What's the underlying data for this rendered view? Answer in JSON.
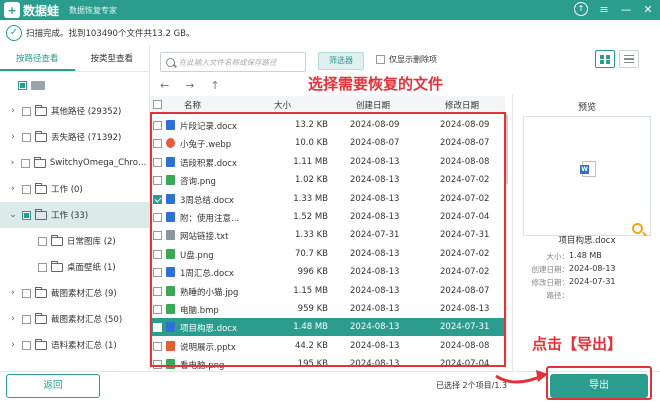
{
  "titlebar": {
    "logo_glyph": "+",
    "app_name": "数据蛙",
    "subtitle": "数据恢复专家",
    "update_glyph": "↑",
    "menu_glyph": "≡",
    "min_glyph": "—",
    "close_glyph": "✕"
  },
  "scan": {
    "check_glyph": "✓",
    "status": "扫描完成。找到103490个文件共13.2 GB。"
  },
  "left_panel": {
    "tabs": [
      {
        "label": "按路径查看",
        "active": true
      },
      {
        "label": "按类型查看",
        "active": false
      }
    ],
    "tree": [
      {
        "label": "",
        "indent": 0,
        "arrow": "",
        "state": "partial",
        "icon": "drive"
      },
      {
        "label": "其他路径 (29352)",
        "indent": 1,
        "arrow": "›",
        "state": "none",
        "icon": "folder"
      },
      {
        "label": "丢失路径 (71392)",
        "indent": 1,
        "arrow": "›",
        "state": "none",
        "icon": "folder"
      },
      {
        "label": "SwitchyOmega_Chromium",
        "indent": 1,
        "arrow": "›",
        "state": "none",
        "icon": "folder"
      },
      {
        "label": "工作 (0)",
        "indent": 1,
        "arrow": "›",
        "state": "none",
        "icon": "folder"
      },
      {
        "label": "工作 (33)",
        "indent": 1,
        "arrow": "⌄",
        "state": "partial",
        "icon": "folder",
        "selected": true
      },
      {
        "label": "日常图库 (2)",
        "indent": 2,
        "arrow": "",
        "state": "none",
        "icon": "folder"
      },
      {
        "label": "桌面壁纸 (1)",
        "indent": 2,
        "arrow": "",
        "state": "none",
        "icon": "folder"
      },
      {
        "label": "截图素材汇总 (9)",
        "indent": 1,
        "arrow": "›",
        "state": "none",
        "icon": "folder"
      },
      {
        "label": "截图素材汇总 (50)",
        "indent": 1,
        "arrow": "›",
        "state": "none",
        "icon": "folder"
      },
      {
        "label": "语料素材汇总 (1)",
        "indent": 1,
        "arrow": "›",
        "state": "none",
        "icon": "folder"
      }
    ]
  },
  "toolbar": {
    "search_placeholder": "在此输入文件名称或保存路径",
    "filter_label": "筛选器",
    "show_deleted_label": "仅显示删除项"
  },
  "nav": {
    "back_glyph": "←",
    "forward_glyph": "→",
    "up_glyph": "↑"
  },
  "annotation": {
    "title": "选择需要恢复的文件",
    "export_hint": "点击【导出】"
  },
  "table": {
    "columns": [
      "名称",
      "大小",
      "创建日期",
      "修改日期"
    ],
    "rows": [
      {
        "name": "片段记录.docx",
        "size": "13.2 KB",
        "created": "2024-08-09",
        "modified": "2024-08-09",
        "type": "doc",
        "checked": false,
        "selected": false
      },
      {
        "name": "小兔子.webp",
        "size": "10.0 KB",
        "created": "2024-08-07",
        "modified": "2024-08-07",
        "type": "webp",
        "checked": false,
        "selected": false
      },
      {
        "name": "语段积累.docx",
        "size": "1.11 MB",
        "created": "2024-08-13",
        "modified": "2024-08-08",
        "type": "doc",
        "checked": false,
        "selected": false
      },
      {
        "name": "咨询.png",
        "size": "1.02 KB",
        "created": "2024-08-13",
        "modified": "2024-07-02",
        "type": "img",
        "checked": false,
        "selected": false
      },
      {
        "name": "3周总结.docx",
        "size": "1.33 MB",
        "created": "2024-08-13",
        "modified": "2024-07-02",
        "type": "doc",
        "checked": true,
        "selected": false
      },
      {
        "name": "附：使用注意...",
        "size": "1.52 MB",
        "created": "2024-08-13",
        "modified": "2024-07-04",
        "type": "doc",
        "checked": false,
        "selected": false
      },
      {
        "name": "网站链接.txt",
        "size": "1.33 KB",
        "created": "2024-07-31",
        "modified": "2024-07-31",
        "type": "txt",
        "checked": false,
        "selected": false
      },
      {
        "name": "U盘.png",
        "size": "70.7 KB",
        "created": "2024-08-13",
        "modified": "2024-07-02",
        "type": "img",
        "checked": false,
        "selected": false
      },
      {
        "name": "1周汇总.docx",
        "size": "996 KB",
        "created": "2024-08-13",
        "modified": "2024-07-02",
        "type": "doc",
        "checked": false,
        "selected": false
      },
      {
        "name": "熟睡的小猫.jpg",
        "size": "1.15 MB",
        "created": "2024-08-13",
        "modified": "2024-08-07",
        "type": "img",
        "checked": false,
        "selected": false
      },
      {
        "name": "电脑.bmp",
        "size": "959 KB",
        "created": "2024-08-13",
        "modified": "2024-08-13",
        "type": "img",
        "checked": false,
        "selected": false
      },
      {
        "name": "项目构思.docx",
        "size": "1.48 MB",
        "created": "2024-08-13",
        "modified": "2024-07-31",
        "type": "doc",
        "checked": true,
        "selected": true
      },
      {
        "name": "说明展示.pptx",
        "size": "44.2 KB",
        "created": "2024-08-13",
        "modified": "2024-08-08",
        "type": "ppt",
        "checked": false,
        "selected": false
      },
      {
        "name": "看电脑.png",
        "size": "195 KB",
        "created": "2024-08-13",
        "modified": "2024-07-04",
        "type": "img",
        "checked": false,
        "selected": false
      }
    ]
  },
  "preview": {
    "title": "预览",
    "file_name": "项目构思.docx",
    "meta": [
      {
        "label": "大小：",
        "value": "1.48 MB"
      },
      {
        "label": "创建日期：",
        "value": "2024-08-13"
      },
      {
        "label": "修改日期：",
        "value": "2024-07-31"
      },
      {
        "label": "路径：",
        "value": ""
      }
    ]
  },
  "bottom": {
    "back_label": "返回",
    "status": "已选择 2个项目/1.3",
    "export_label": "导出"
  },
  "colors": {
    "accent": "#2a9d8f",
    "annotation": "#e4323a"
  }
}
